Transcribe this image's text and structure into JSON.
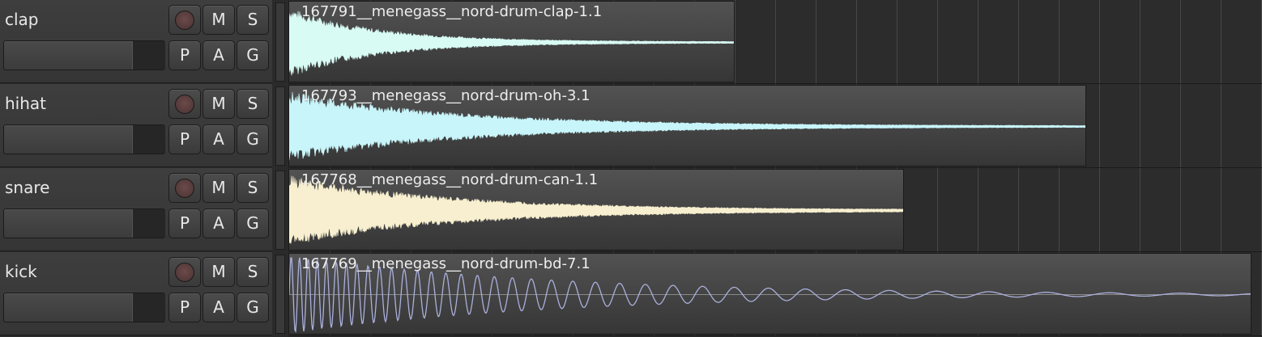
{
  "colors": {
    "clap_wave": "#d8fbf4",
    "hihat_wave": "#c8f5fa",
    "snare_wave": "#f7efcf",
    "kick_wave": "#aab0dc"
  },
  "buttons": {
    "mute": "M",
    "solo": "S",
    "phase": "P",
    "automation": "A",
    "group": "G"
  },
  "tracks": [
    {
      "name": "clap",
      "region": "167791__menegass__nord-drum-clap-1.1"
    },
    {
      "name": "hihat",
      "region": "167793__menegass__nord-drum-oh-3.1"
    },
    {
      "name": "snare",
      "region": "167768__menegass__nord-drum-can-1.1"
    },
    {
      "name": "kick",
      "region": "167769__menegass__nord-drum-bd-7.1"
    }
  ]
}
